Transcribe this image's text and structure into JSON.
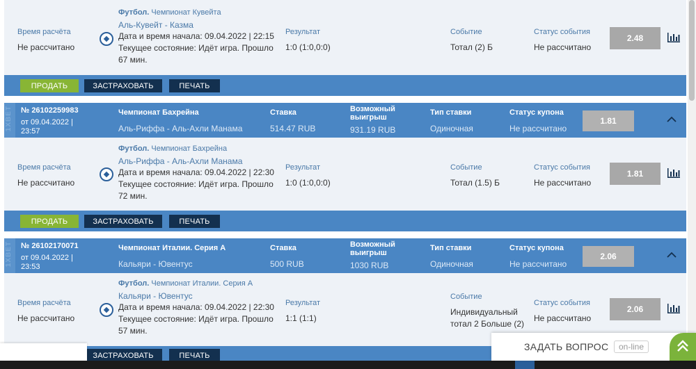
{
  "blocks": [
    {
      "sport": "Футбол.",
      "league": "Чемпионат Кувейта",
      "teams": "Аль-Кувейт - Казма",
      "start": "Дата и время начала: 09.04.2022 | 22:15",
      "state1": "Текущее состояние: Идёт игра. Прошло",
      "state2": "67 мин.",
      "calc_label": "Время расчёта",
      "calc_value": "Не рассчитано",
      "result_label": "Результат",
      "result_value": "1:0 (1:0,0:0)",
      "event_label": "Событие",
      "event_value": "Тотал (2) Б",
      "event_value2": "",
      "status_label": "Статус события",
      "status_value": "Не рассчитано",
      "odd": "2.48"
    },
    {
      "sport": "Футбол.",
      "league": "Чемпионат Бахрейна",
      "teams": "Аль-Риффа - Аль-Ахли Манама",
      "start": "Дата и время начала: 09.04.2022 | 22:30",
      "state1": "Текущее состояние: Идёт игра. Прошло",
      "state2": "72 мин.",
      "calc_label": "Время расчёта",
      "calc_value": "Не рассчитано",
      "result_label": "Результат",
      "result_value": "1:0 (1:0,0:0)",
      "event_label": "Событие",
      "event_value": "Тотал (1.5) Б",
      "event_value2": "",
      "status_label": "Статус события",
      "status_value": "Не рассчитано",
      "odd": "1.81"
    },
    {
      "sport": "Футбол.",
      "league": "Чемпионат Италии. Серия А",
      "teams": "Кальяри - Ювентус",
      "start": "Дата и время начала: 09.04.2022 | 22:30",
      "state1": "Текущее состояние: Идёт игра. Прошло",
      "state2": "57 мин.",
      "calc_label": "Время расчёта",
      "calc_value": "Не рассчитано",
      "result_label": "Результат",
      "result_value": "1:1 (1:1)",
      "event_label": "Событие",
      "event_value": "Индивидуальный",
      "event_value2": "тотал 2 Больше (2)",
      "status_label": "Статус события",
      "status_value": "Не рассчитано",
      "odd": "2.06"
    }
  ],
  "coupons": [
    {
      "logo": "1XBET",
      "number": "№ 26102259983",
      "date1": "от 09.04.2022 |",
      "date2": "23:57",
      "league": "Чемпионат Бахрейна",
      "teams": "Аль-Риффа - Аль-Ахли Манама",
      "stake_label": "Ставка",
      "stake": "514.47 RUB",
      "win_label1": "Возможный",
      "win_label2": "выигрыш",
      "win": "931.19 RUB",
      "type_label": "Тип ставки",
      "type": "Одиночная",
      "status_label": "Статус купона",
      "status": "Не рассчитано",
      "odd": "1.81"
    },
    {
      "logo": "1XBET",
      "number": "№ 26102170071",
      "date1": "от 09.04.2022 |",
      "date2": "23:53",
      "league": "Чемпионат Италии. Серия А",
      "teams": "Кальяри - Ювентус",
      "stake_label": "Ставка",
      "stake": "500 RUB",
      "win_label1": "Возможный",
      "win_label2": "выигрыш",
      "win": "1030 RUB",
      "type_label": "Тип ставки",
      "type": "Одиночная",
      "status_label": "Статус купона",
      "status": "Не рассчитано",
      "odd": "2.06"
    }
  ],
  "actions": {
    "sell": "ПРОДАТЬ",
    "insure": "ЗАСТРАХОВАТЬ",
    "print": "ПЕЧАТЬ"
  },
  "chat": {
    "title": "ЗАДАТЬ ВОПРОС",
    "status": "on-line"
  },
  "colors": {
    "header_blue": "#4a86c4",
    "sell_green": "#88b535",
    "dark_navy": "#13304f",
    "odd_gray": "#a8a8a8"
  }
}
